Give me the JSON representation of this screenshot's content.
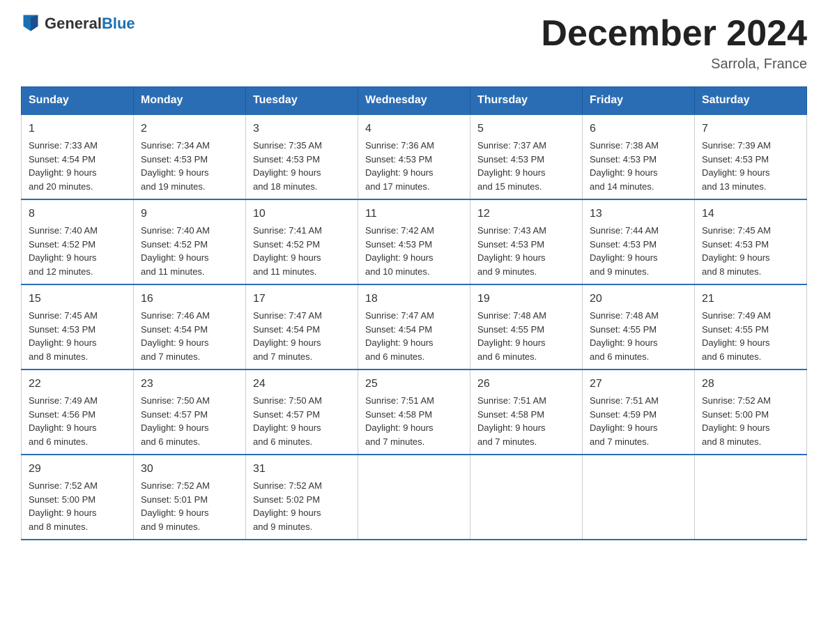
{
  "header": {
    "logo_text_general": "General",
    "logo_text_blue": "Blue",
    "month_title": "December 2024",
    "location": "Sarrola, France"
  },
  "weekdays": [
    "Sunday",
    "Monday",
    "Tuesday",
    "Wednesday",
    "Thursday",
    "Friday",
    "Saturday"
  ],
  "weeks": [
    [
      {
        "day": "1",
        "sunrise": "7:33 AM",
        "sunset": "4:54 PM",
        "daylight": "9 hours and 20 minutes."
      },
      {
        "day": "2",
        "sunrise": "7:34 AM",
        "sunset": "4:53 PM",
        "daylight": "9 hours and 19 minutes."
      },
      {
        "day": "3",
        "sunrise": "7:35 AM",
        "sunset": "4:53 PM",
        "daylight": "9 hours and 18 minutes."
      },
      {
        "day": "4",
        "sunrise": "7:36 AM",
        "sunset": "4:53 PM",
        "daylight": "9 hours and 17 minutes."
      },
      {
        "day": "5",
        "sunrise": "7:37 AM",
        "sunset": "4:53 PM",
        "daylight": "9 hours and 15 minutes."
      },
      {
        "day": "6",
        "sunrise": "7:38 AM",
        "sunset": "4:53 PM",
        "daylight": "9 hours and 14 minutes."
      },
      {
        "day": "7",
        "sunrise": "7:39 AM",
        "sunset": "4:53 PM",
        "daylight": "9 hours and 13 minutes."
      }
    ],
    [
      {
        "day": "8",
        "sunrise": "7:40 AM",
        "sunset": "4:52 PM",
        "daylight": "9 hours and 12 minutes."
      },
      {
        "day": "9",
        "sunrise": "7:40 AM",
        "sunset": "4:52 PM",
        "daylight": "9 hours and 11 minutes."
      },
      {
        "day": "10",
        "sunrise": "7:41 AM",
        "sunset": "4:52 PM",
        "daylight": "9 hours and 11 minutes."
      },
      {
        "day": "11",
        "sunrise": "7:42 AM",
        "sunset": "4:53 PM",
        "daylight": "9 hours and 10 minutes."
      },
      {
        "day": "12",
        "sunrise": "7:43 AM",
        "sunset": "4:53 PM",
        "daylight": "9 hours and 9 minutes."
      },
      {
        "day": "13",
        "sunrise": "7:44 AM",
        "sunset": "4:53 PM",
        "daylight": "9 hours and 9 minutes."
      },
      {
        "day": "14",
        "sunrise": "7:45 AM",
        "sunset": "4:53 PM",
        "daylight": "9 hours and 8 minutes."
      }
    ],
    [
      {
        "day": "15",
        "sunrise": "7:45 AM",
        "sunset": "4:53 PM",
        "daylight": "9 hours and 8 minutes."
      },
      {
        "day": "16",
        "sunrise": "7:46 AM",
        "sunset": "4:54 PM",
        "daylight": "9 hours and 7 minutes."
      },
      {
        "day": "17",
        "sunrise": "7:47 AM",
        "sunset": "4:54 PM",
        "daylight": "9 hours and 7 minutes."
      },
      {
        "day": "18",
        "sunrise": "7:47 AM",
        "sunset": "4:54 PM",
        "daylight": "9 hours and 6 minutes."
      },
      {
        "day": "19",
        "sunrise": "7:48 AM",
        "sunset": "4:55 PM",
        "daylight": "9 hours and 6 minutes."
      },
      {
        "day": "20",
        "sunrise": "7:48 AM",
        "sunset": "4:55 PM",
        "daylight": "9 hours and 6 minutes."
      },
      {
        "day": "21",
        "sunrise": "7:49 AM",
        "sunset": "4:55 PM",
        "daylight": "9 hours and 6 minutes."
      }
    ],
    [
      {
        "day": "22",
        "sunrise": "7:49 AM",
        "sunset": "4:56 PM",
        "daylight": "9 hours and 6 minutes."
      },
      {
        "day": "23",
        "sunrise": "7:50 AM",
        "sunset": "4:57 PM",
        "daylight": "9 hours and 6 minutes."
      },
      {
        "day": "24",
        "sunrise": "7:50 AM",
        "sunset": "4:57 PM",
        "daylight": "9 hours and 6 minutes."
      },
      {
        "day": "25",
        "sunrise": "7:51 AM",
        "sunset": "4:58 PM",
        "daylight": "9 hours and 7 minutes."
      },
      {
        "day": "26",
        "sunrise": "7:51 AM",
        "sunset": "4:58 PM",
        "daylight": "9 hours and 7 minutes."
      },
      {
        "day": "27",
        "sunrise": "7:51 AM",
        "sunset": "4:59 PM",
        "daylight": "9 hours and 7 minutes."
      },
      {
        "day": "28",
        "sunrise": "7:52 AM",
        "sunset": "5:00 PM",
        "daylight": "9 hours and 8 minutes."
      }
    ],
    [
      {
        "day": "29",
        "sunrise": "7:52 AM",
        "sunset": "5:00 PM",
        "daylight": "9 hours and 8 minutes."
      },
      {
        "day": "30",
        "sunrise": "7:52 AM",
        "sunset": "5:01 PM",
        "daylight": "9 hours and 9 minutes."
      },
      {
        "day": "31",
        "sunrise": "7:52 AM",
        "sunset": "5:02 PM",
        "daylight": "9 hours and 9 minutes."
      },
      null,
      null,
      null,
      null
    ]
  ],
  "labels": {
    "sunrise": "Sunrise:",
    "sunset": "Sunset:",
    "daylight": "Daylight:"
  }
}
